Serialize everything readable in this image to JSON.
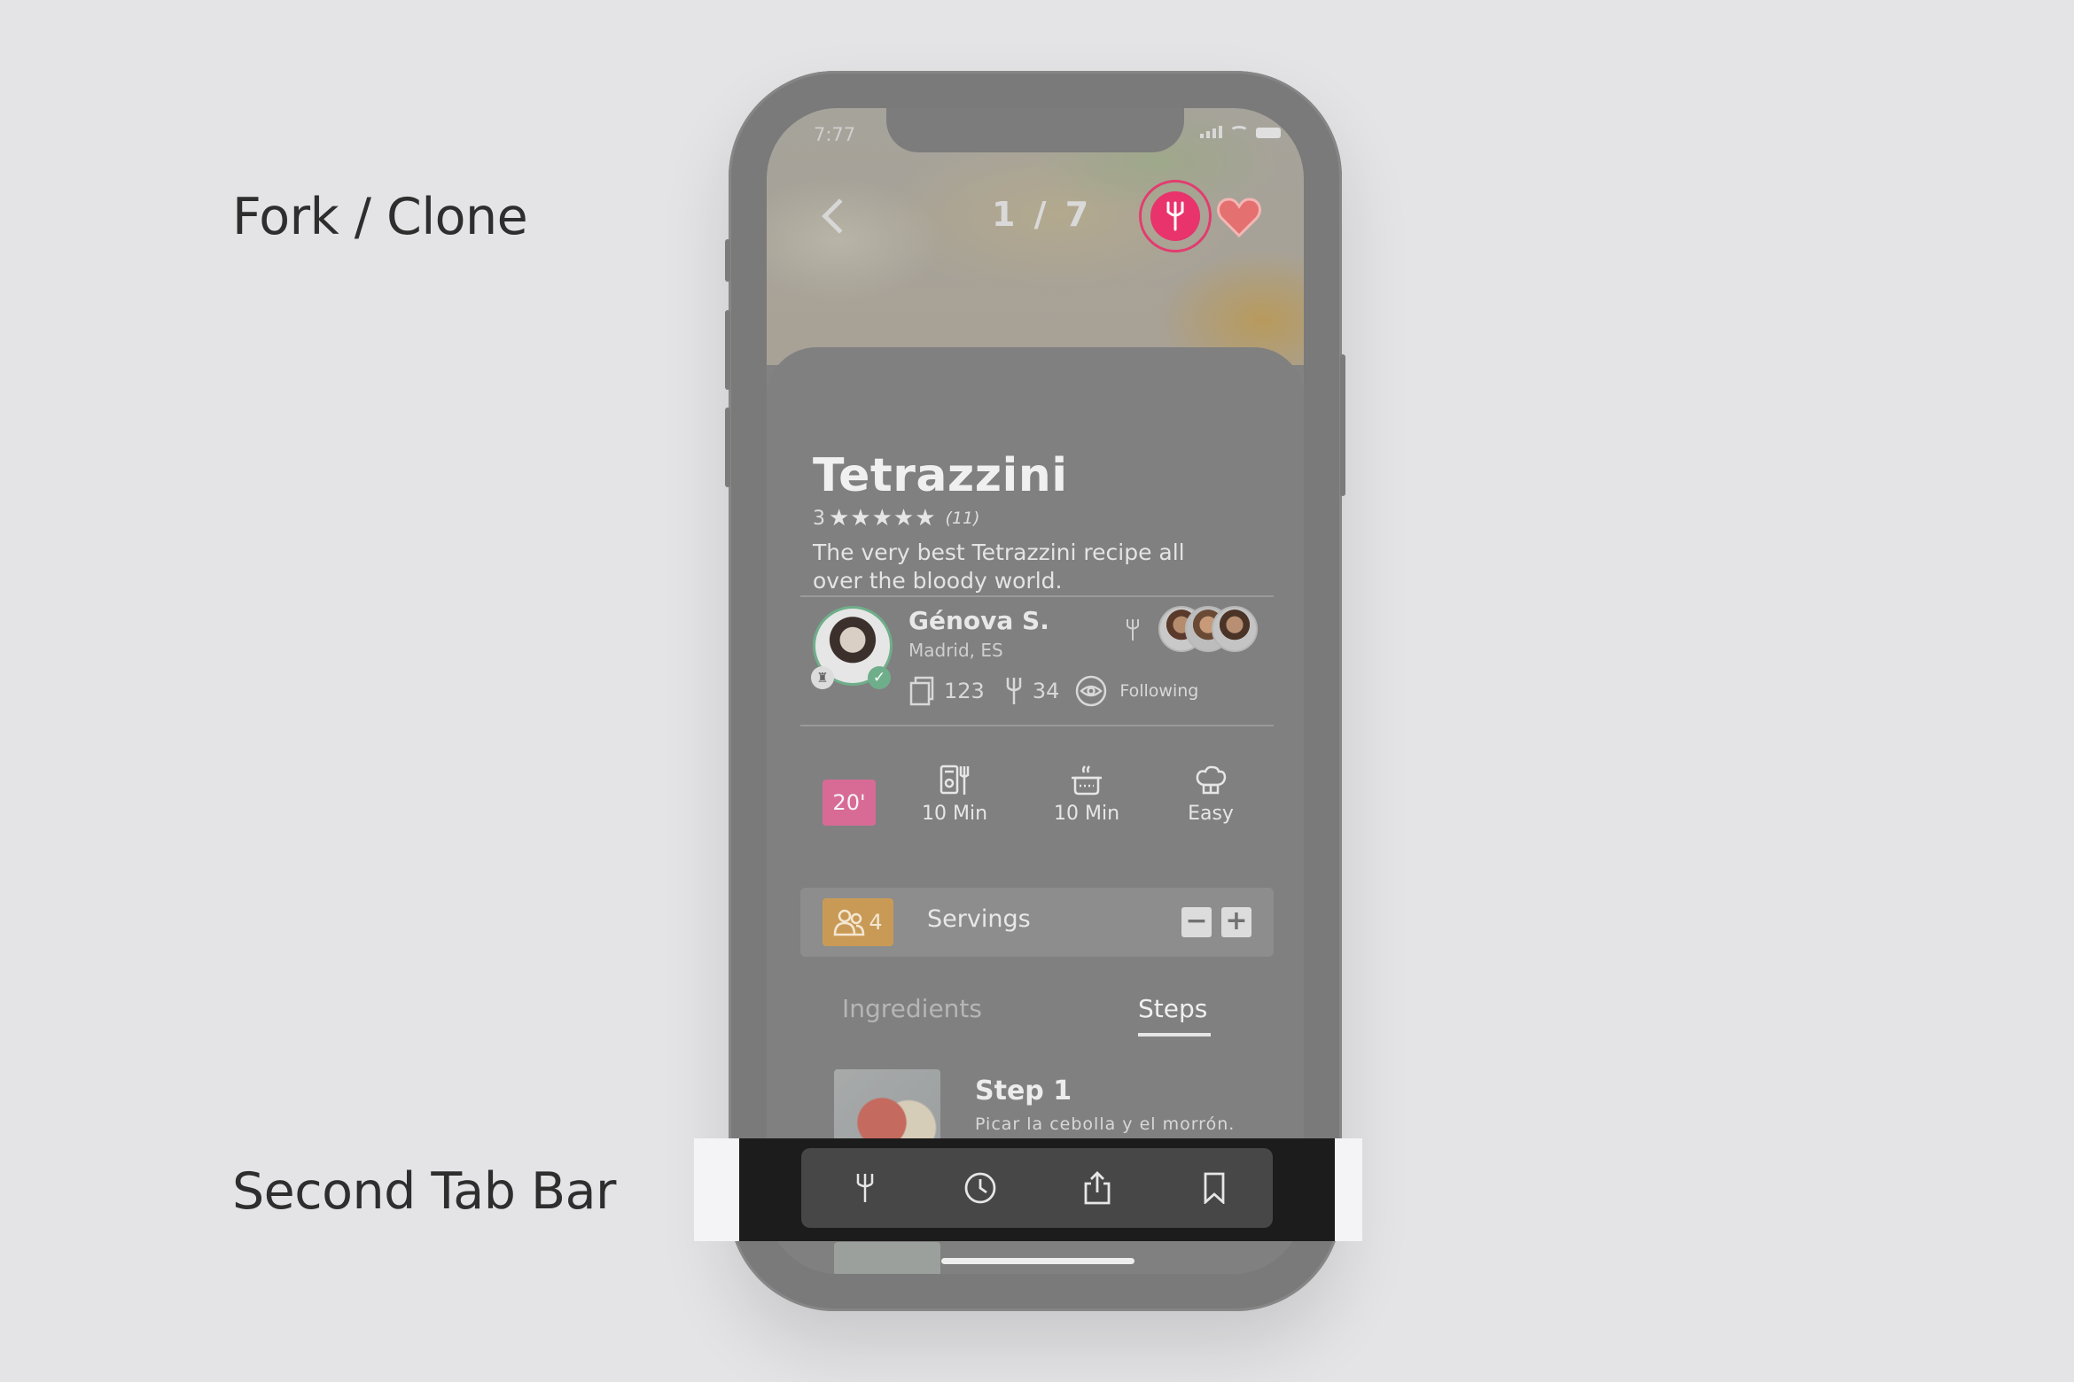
{
  "annotations": {
    "fork_clone": "Fork / Clone",
    "second_tab_bar": "Second Tab Bar"
  },
  "status_bar": {
    "time": "7:77"
  },
  "header": {
    "pager": "1 / 7"
  },
  "recipe": {
    "title": "Tetrazzini",
    "rating_value": "3",
    "stars": "★★★★★",
    "rating_count": "(11)",
    "description": "The very best Tetrazzini recipe all over the bloody world."
  },
  "author": {
    "name": "Génova S.",
    "location": "Madrid, ES",
    "recipes_count": "123",
    "forks_count": "34",
    "follow_label": "Following"
  },
  "meta": {
    "total_time": "20'",
    "prep_time": "10 Min",
    "cook_time": "10 Min",
    "difficulty": "Easy"
  },
  "servings": {
    "count": "4",
    "label": "Servings",
    "minus": "−",
    "plus": "+"
  },
  "tabs": {
    "ingredients": "Ingredients",
    "steps": "Steps"
  },
  "steps": [
    {
      "title": "Step 1",
      "text": "Picar la cebolla y el morrón."
    }
  ],
  "tab_bar": {
    "icons": [
      "fork-icon",
      "clock-icon",
      "share-icon",
      "bookmark-icon"
    ]
  },
  "colors": {
    "accent_pink": "#e8336c",
    "time_badge": "#d86b96",
    "servings_badge": "#c99a56",
    "verified_green": "#6fae8a"
  }
}
